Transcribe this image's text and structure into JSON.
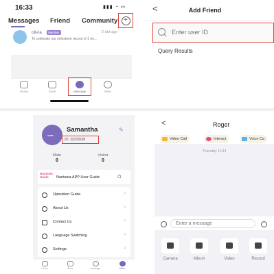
{
  "messages_screen": {
    "status_time": "16:33",
    "tabs": [
      "Messages",
      "Friend",
      "Community"
    ],
    "add_icon": "plus-circle-icon",
    "conversation": {
      "name": "olivia",
      "badge": "Member",
      "time": "2 did ago",
      "preview": "To celebrate our milestone record of 1 mi..."
    },
    "nav": [
      "Home",
      "Store",
      "Message",
      "Mine"
    ]
  },
  "add_friend_screen": {
    "back": "<",
    "title": "Add Friend",
    "input_placeholder": "Enter user ID",
    "query_results": "Query Results"
  },
  "profile_screen": {
    "name": "Samantha",
    "user_id": "ID: 10233638",
    "stats": [
      {
        "label": "Mate",
        "value": "0"
      },
      {
        "label": "Visitor",
        "value": "0"
      }
    ],
    "guide_logo_line1": "Nantasia",
    "guide_logo_line2": "Guide",
    "guide_text": "Nantasia APP User Guide",
    "menu": [
      "Operation Guide",
      "About Us",
      "Contact Us",
      "Language Switching",
      "Settings"
    ],
    "nav": [
      "Home",
      "Store",
      "Message",
      "Mine"
    ]
  },
  "chat_screen": {
    "back": "<",
    "title": "Roger",
    "actions": [
      {
        "label": "Video Call",
        "color": "#f4b63b"
      },
      {
        "label": "Interact",
        "color": "#e84a6d"
      },
      {
        "label": "Voice Ca",
        "color": "#5ab3e8"
      }
    ],
    "timestamp": "Thursday 11:44",
    "input_placeholder": "Enter a message",
    "tools": [
      "Camera",
      "Album",
      "Video",
      "Record"
    ]
  },
  "colors": {
    "accent": "#7a68b8",
    "highlight": "#e0453a"
  }
}
